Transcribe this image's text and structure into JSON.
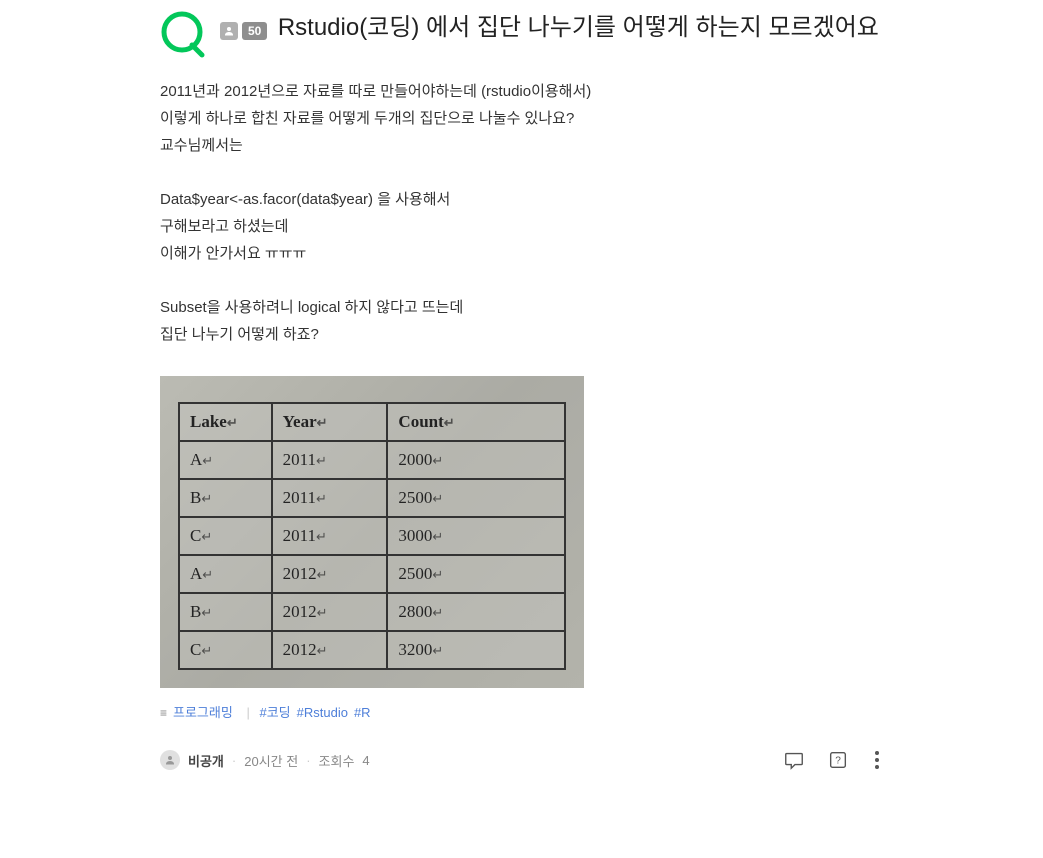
{
  "header": {
    "points_badge": "50",
    "title": "Rstudio(코딩) 에서 집단 나누기를 어떻게 하는지 모르겠어요"
  },
  "body": {
    "lines": [
      "2011년과 2012년으로 자료를 따로 만들어야하는데 (rstudio이용해서)",
      "이렇게 하나로 합친 자료를 어떻게 두개의 집단으로 나눌수 있나요?",
      "교수님께서는",
      "",
      "Data$year<-as.facor(data$year) 을 사용해서",
      "구해보라고 하셨는데",
      "이해가 안가서요 ㅠㅠㅠ",
      "",
      "Subset을 사용하려니 logical 하지 않다고 뜨는데",
      "집단 나누기 어떻게 하죠?"
    ]
  },
  "table": {
    "headers": [
      "Lake",
      "Year",
      "Count"
    ],
    "rows": [
      [
        "A",
        "2011",
        "2000"
      ],
      [
        "B",
        "2011",
        "2500"
      ],
      [
        "C",
        "2011",
        "3000"
      ],
      [
        "A",
        "2012",
        "2500"
      ],
      [
        "B",
        "2012",
        "2800"
      ],
      [
        "C",
        "2012",
        "3200"
      ]
    ]
  },
  "tags": {
    "prefix_icon": "≡",
    "category": "프로그래밍",
    "items": [
      "#코딩",
      "#Rstudio",
      "#R"
    ]
  },
  "footer": {
    "author": "비공개",
    "time": "20시간 전",
    "views_label": "조회수",
    "views": "4"
  }
}
